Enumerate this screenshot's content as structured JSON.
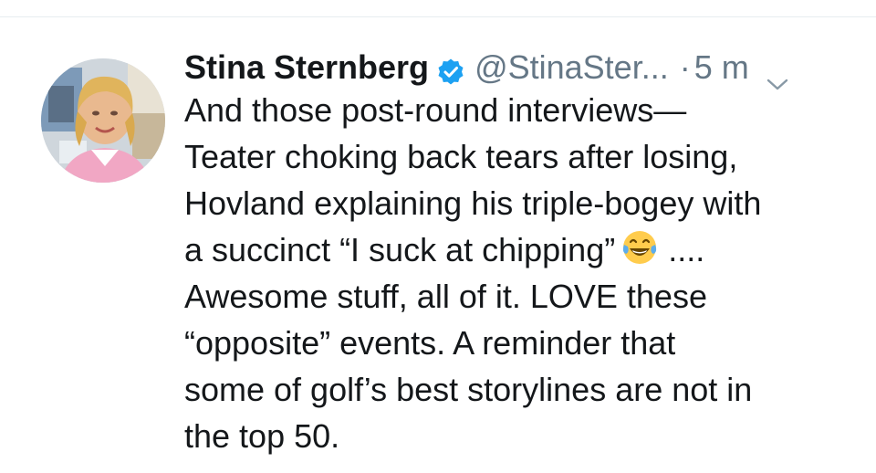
{
  "tweet": {
    "author_name": "Stina Sternberg",
    "handle": "@StinaSter...",
    "separator": "·",
    "time": "5 m",
    "verified": true,
    "emoji": "face-with-tears-of-joy",
    "lines": [
      "And those post-round interviews—",
      "Teater choking back tears after losing,",
      "Hovland explaining his triple-bogey with",
      "a succinct “I suck at chipping”",
      "....",
      "Awesome stuff, all of it. LOVE these",
      "“opposite” events. A reminder that",
      "some of golf’s best storylines are not in",
      "the top 50."
    ]
  },
  "colors": {
    "text": "#14171a",
    "secondary": "#657786",
    "verified_badge": "#1da1f2",
    "divider": "#e6ecf0"
  }
}
